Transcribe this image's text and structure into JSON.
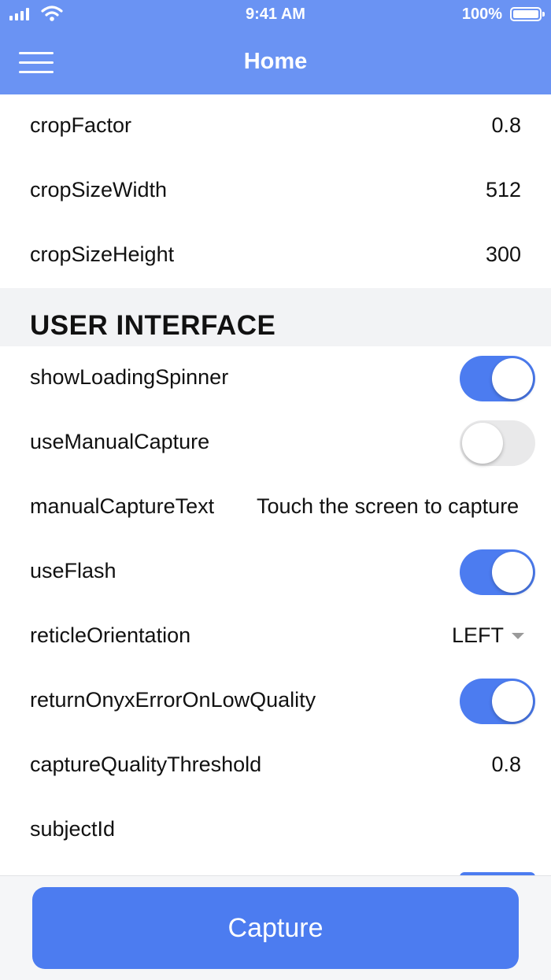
{
  "status_bar": {
    "time": "9:41 AM",
    "battery": "100%"
  },
  "nav": {
    "title": "Home"
  },
  "settings_top": [
    {
      "label": "cropFactor",
      "value": "0.8"
    },
    {
      "label": "cropSizeWidth",
      "value": "512"
    },
    {
      "label": "cropSizeHeight",
      "value": "300"
    }
  ],
  "section": {
    "title": "USER INTERFACE"
  },
  "ui_settings": {
    "showLoadingSpinner": {
      "label": "showLoadingSpinner",
      "enabled": true
    },
    "useManualCapture": {
      "label": "useManualCapture",
      "enabled": false
    },
    "manualCaptureText": {
      "label": "manualCaptureText",
      "value": "Touch the screen to capture"
    },
    "useFlash": {
      "label": "useFlash",
      "enabled": true
    },
    "reticleOrientation": {
      "label": "reticleOrientation",
      "value": "LEFT"
    },
    "returnOnyxErrorOnLowQuality": {
      "label": "returnOnyxErrorOnLowQuality",
      "enabled": true
    },
    "captureQualityThreshold": {
      "label": "captureQualityThreshold",
      "value": "0.8"
    },
    "subjectId": {
      "label": "subjectId",
      "value": ""
    }
  },
  "footer": {
    "button_label": "Capture"
  },
  "colors": {
    "nav_bg": "#6a93f3",
    "accent": "#4c7cf0",
    "section_bg": "#f2f3f5"
  }
}
